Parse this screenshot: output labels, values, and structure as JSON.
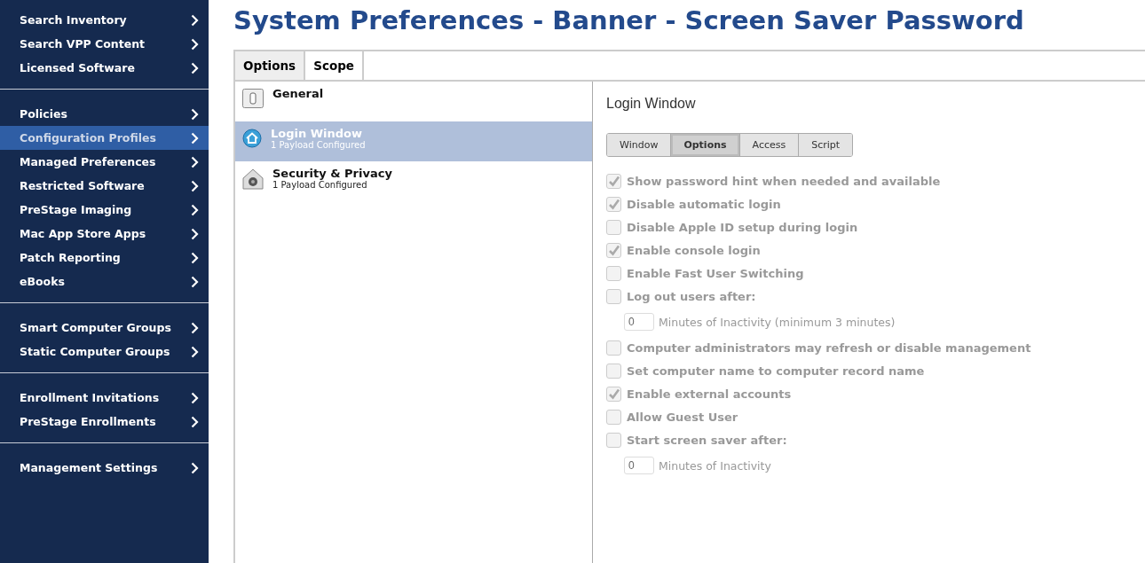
{
  "sidebar": {
    "groups": [
      {
        "items": [
          {
            "label": "Search Inventory",
            "selected": false
          },
          {
            "label": "Search VPP Content",
            "selected": false
          },
          {
            "label": "Licensed Software",
            "selected": false
          }
        ]
      },
      {
        "items": [
          {
            "label": "Policies",
            "selected": false
          },
          {
            "label": "Configuration Profiles",
            "selected": true
          },
          {
            "label": "Managed Preferences",
            "selected": false
          },
          {
            "label": "Restricted Software",
            "selected": false
          },
          {
            "label": "PreStage Imaging",
            "selected": false
          },
          {
            "label": "Mac App Store Apps",
            "selected": false
          },
          {
            "label": "Patch Reporting",
            "selected": false
          },
          {
            "label": "eBooks",
            "selected": false
          }
        ]
      },
      {
        "items": [
          {
            "label": "Smart Computer Groups",
            "selected": false
          },
          {
            "label": "Static Computer Groups",
            "selected": false
          }
        ]
      },
      {
        "items": [
          {
            "label": "Enrollment Invitations",
            "selected": false
          },
          {
            "label": "PreStage Enrollments",
            "selected": false
          }
        ]
      },
      {
        "items": [
          {
            "label": "Management Settings",
            "selected": false
          }
        ]
      }
    ]
  },
  "page_title": "System Preferences - Banner - Screen Saver Password",
  "tabs": [
    {
      "label": "Options",
      "selected": true
    },
    {
      "label": "Scope",
      "selected": false
    }
  ],
  "payloads": [
    {
      "kind": "general",
      "name": "General",
      "selected": false
    },
    {
      "kind": "login",
      "name": "Login Window",
      "subtitle": "1 Payload Configured",
      "selected": true
    },
    {
      "kind": "security",
      "name": "Security & Privacy",
      "subtitle": "1 Payload Configured",
      "selected": false
    }
  ],
  "panel": {
    "title": "Login Window",
    "subtabs": [
      {
        "label": "Window",
        "selected": false
      },
      {
        "label": "Options",
        "selected": true
      },
      {
        "label": "Access",
        "selected": false
      },
      {
        "label": "Script",
        "selected": false
      }
    ],
    "options": [
      {
        "kind": "checkbox",
        "label": "Show password hint when needed and available",
        "checked": true
      },
      {
        "kind": "checkbox",
        "label": "Disable automatic login",
        "checked": true
      },
      {
        "kind": "checkbox",
        "label": "Disable Apple ID setup during login",
        "checked": false
      },
      {
        "kind": "checkbox",
        "label": "Enable console login",
        "checked": true
      },
      {
        "kind": "checkbox",
        "label": "Enable Fast User Switching",
        "checked": false
      },
      {
        "kind": "checkbox",
        "label": "Log out users after:",
        "checked": false
      },
      {
        "kind": "minutes",
        "value": "0",
        "label": "Minutes of Inactivity (minimum 3 minutes)"
      },
      {
        "kind": "checkbox",
        "label": "Computer administrators may refresh or disable management",
        "checked": false
      },
      {
        "kind": "checkbox",
        "label": "Set computer name to computer record name",
        "checked": false
      },
      {
        "kind": "checkbox",
        "label": "Enable external accounts",
        "checked": true
      },
      {
        "kind": "checkbox",
        "label": "Allow Guest User",
        "checked": false
      },
      {
        "kind": "checkbox",
        "label": "Start screen saver after:",
        "checked": false
      },
      {
        "kind": "minutes",
        "value": "0",
        "label": "Minutes of Inactivity"
      }
    ]
  }
}
